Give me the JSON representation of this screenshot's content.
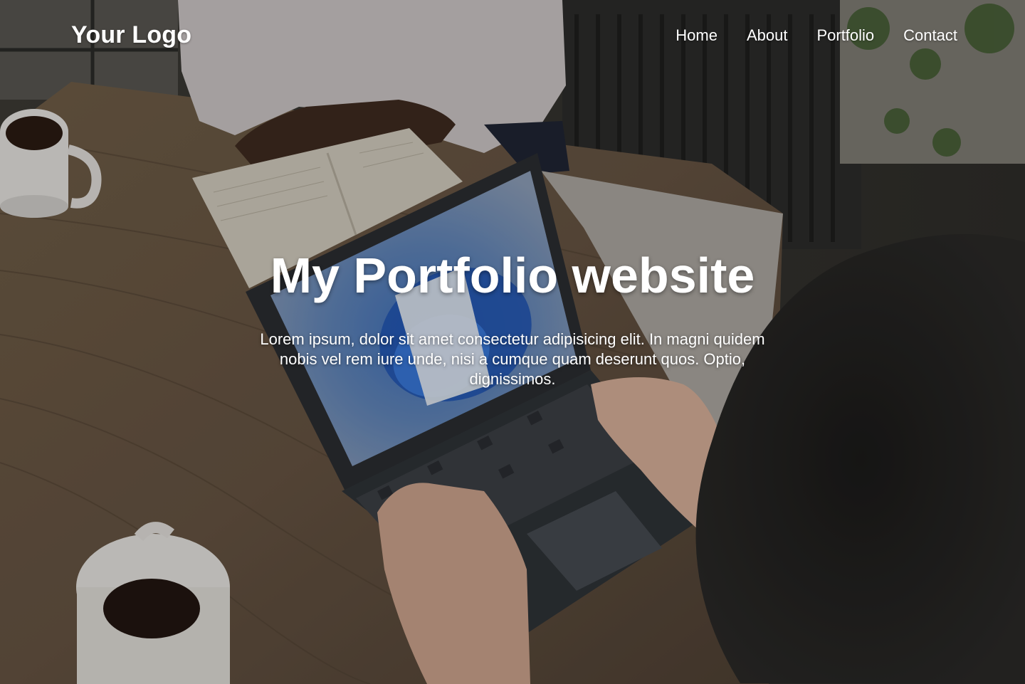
{
  "header": {
    "logo": "Your Logo",
    "nav": [
      "Home",
      "About",
      "Portfolio",
      "Contact"
    ]
  },
  "hero": {
    "title": "My Portfolio website",
    "text": "Lorem ipsum, dolor sit amet consectetur adipisicing elit. In magni quidem nobis vel rem iure unde, nisi a cumque quam deserunt quos. Optio, dignissimos."
  },
  "background": {
    "description_colors": {
      "table": "#6b5b45",
      "overlay": "rgba(0,0,0,0.18)"
    }
  }
}
